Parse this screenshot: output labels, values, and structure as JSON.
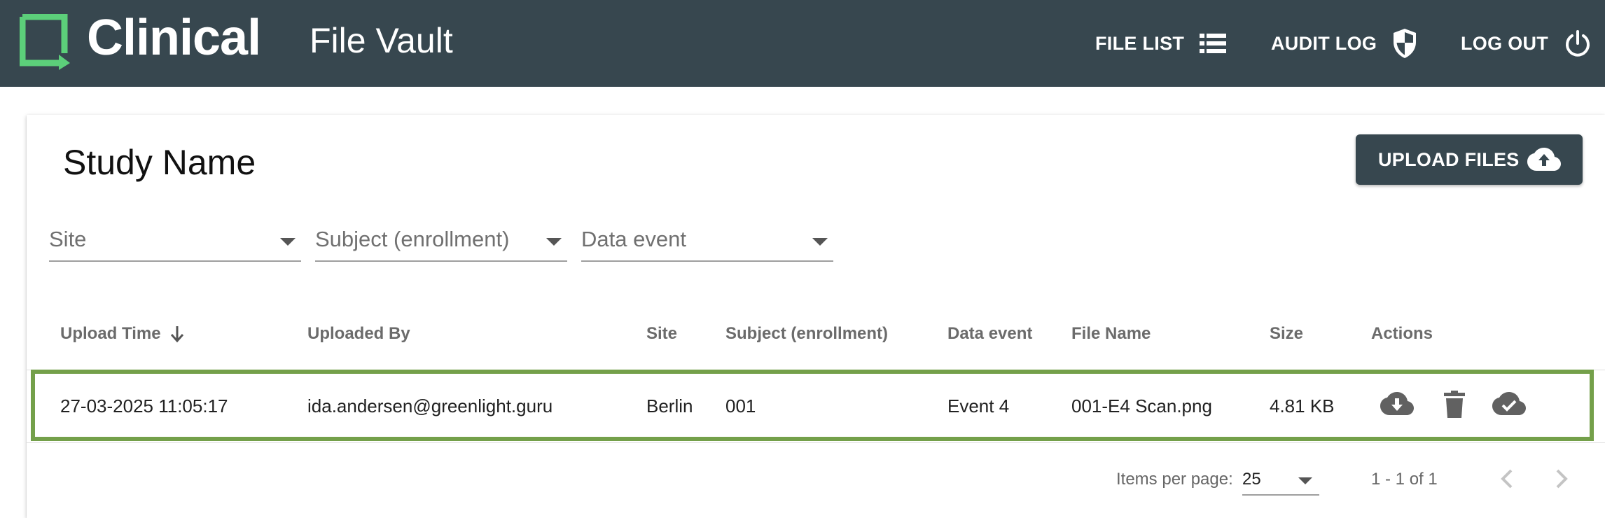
{
  "header": {
    "brand": "Clinical",
    "app_title": "File Vault",
    "nav": {
      "file_list": "FILE LIST",
      "audit_log": "AUDIT LOG",
      "log_out": "LOG OUT"
    }
  },
  "main": {
    "study_name": "Study Name",
    "upload_button": "UPLOAD FILES",
    "filters": {
      "site": "Site",
      "subject": "Subject (enrollment)",
      "data_event": "Data event"
    },
    "table": {
      "columns": {
        "upload_time": "Upload Time",
        "uploaded_by": "Uploaded By",
        "site": "Site",
        "subject": "Subject (enrollment)",
        "data_event": "Data event",
        "file_name": "File Name",
        "size": "Size",
        "actions": "Actions"
      },
      "sort": {
        "column": "Upload Time",
        "direction": "descending"
      },
      "rows": [
        {
          "upload_time": "27-03-2025 11:05:17",
          "uploaded_by": "ida.andersen@greenlight.guru",
          "site": "Berlin",
          "subject": "001",
          "data_event": "Event 4",
          "file_name": "001-E4 Scan.png",
          "size": "4.81 KB",
          "actions": [
            "download-cloud-icon",
            "delete-icon",
            "verify-cloud-icon"
          ]
        }
      ]
    },
    "paginator": {
      "items_per_page_label": "Items per page:",
      "items_per_page": "25",
      "range": "1 - 1 of 1"
    }
  },
  "colors": {
    "topbar": "#37474f",
    "logo_green": "#5ccf7a",
    "row_highlight": "#74a04a"
  }
}
